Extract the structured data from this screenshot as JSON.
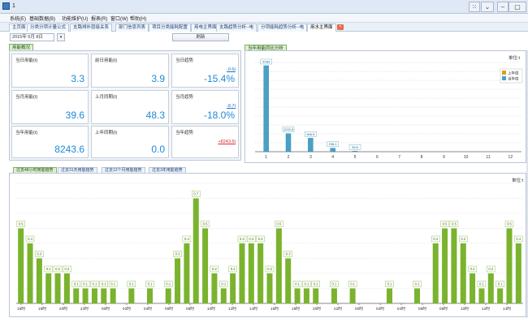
{
  "window": {
    "title": "1"
  },
  "menu": [
    "系统(E)",
    "基础数据(B)",
    "功能维护(U)",
    "报表(R)",
    "窗口(W)",
    "帮助(H)"
  ],
  "tabs": [
    "主页面",
    "分类分项计量公式",
    "支路排补层级关系",
    "部门信息列表",
    "项目分类能耗配置",
    "用电主界面",
    "支路趋势分析--电",
    "分项能耗趋势分析--电",
    "用水主界面"
  ],
  "toolbar": {
    "date": "2015年 5月 8日",
    "refresh_label": "刷新"
  },
  "overview": {
    "tab_label": "用能概况",
    "cards": [
      {
        "label": "当日用能(t)",
        "value": "3.3",
        "sub": ""
      },
      {
        "label": "前日用能(t)",
        "value": "3.9",
        "sub": ""
      },
      {
        "label": "当日趋势",
        "value": "-15.4%",
        "sub": "-0.6t"
      },
      {
        "label": "当月用能(t)",
        "value": "39.6",
        "sub": ""
      },
      {
        "label": "上月同期(t)",
        "value": "48.3",
        "sub": ""
      },
      {
        "label": "当月趋势",
        "value": "-18.0%",
        "sub": "-8.7t"
      },
      {
        "label": "当年用能(t)",
        "value": "8243.6",
        "sub": ""
      },
      {
        "label": "上年同期(t)",
        "value": "0.0",
        "sub": ""
      },
      {
        "label": "当年趋势",
        "value": "",
        "sub": "+8243.6t"
      }
    ]
  },
  "year_chart": {
    "tab_label": "当年用能同比分析",
    "unit": "单位:t"
  },
  "bottom_tabs": [
    "过去48小时用能趋势",
    "过去31天用能趋势",
    "过去12个月用能趋势",
    "过去3年用能趋势"
  ],
  "bottom_chart": {
    "unit": "单位:t"
  },
  "colors": {
    "bar_green": "#7ab32e",
    "bar_blue": "#4aa1c5",
    "last_year": "#d89f1e",
    "accent": "#1e88d6"
  },
  "chart_data": [
    {
      "type": "bar",
      "categories": [
        "1",
        "2",
        "3",
        "4",
        "5",
        "6",
        "7",
        "8",
        "9",
        "10",
        "11",
        "12"
      ],
      "series": [
        {
          "name": "上年值",
          "values": [
            0,
            0,
            0,
            0,
            0,
            0,
            0,
            0,
            0,
            0,
            0,
            0
          ]
        },
        {
          "name": "当年值",
          "values": [
            5784.0,
            1215.0,
            906.5,
            238.1,
            39.6,
            0,
            0,
            0,
            0,
            0,
            0,
            0
          ]
        }
      ],
      "data_labels": [
        "5784",
        "1215.5",
        "906.5",
        "238.1",
        "39.6"
      ],
      "ylim": [
        0,
        6000
      ],
      "legend": "top-right"
    },
    {
      "type": "bar",
      "x_ticks": [
        "16时",
        "18时",
        "20时",
        "22时",
        "00时",
        "02时",
        "04时",
        "06时",
        "08时",
        "10时",
        "12时",
        "14时",
        "16时",
        "18时",
        "20时",
        "22时",
        "00时",
        "02时",
        "04时",
        "06时",
        "08时",
        "10时",
        "12时",
        "14时"
      ],
      "values": [
        0.5,
        0.4,
        0.3,
        0.2,
        0.2,
        0.2,
        0.1,
        0.1,
        0.1,
        0.1,
        0.1,
        0,
        0.1,
        0,
        0.1,
        0,
        0.1,
        0.3,
        0.4,
        0.7,
        0.5,
        0.2,
        0.1,
        0.2,
        0.4,
        0.4,
        0.4,
        0.2,
        0.5,
        0.3,
        0.1,
        0.1,
        0.1,
        0,
        0.1,
        0,
        0.1,
        0,
        0,
        0,
        0.1,
        0,
        0,
        0.1,
        0,
        0.4,
        0.5,
        0.5,
        0.4,
        0.2,
        0.1,
        0.2,
        0.1,
        0.5,
        0.4
      ],
      "data_labels": [
        "0.5",
        "0.4",
        "0.3",
        "0.2",
        "0.2",
        "0.2",
        "0.1",
        "0.1",
        "0.1",
        "0.1",
        "0.1",
        "",
        "0.1",
        "",
        "0.1",
        "",
        "0.1",
        "0.3",
        "0.4",
        "0.7",
        "0.5",
        "0.2",
        "0.1",
        "0.2",
        "0.4",
        "0.4",
        "0.4",
        "0.2",
        "0.5",
        "0.3",
        "0.1",
        "0.1",
        "0.1",
        "",
        "0.1",
        "",
        "0.1",
        "",
        "",
        "",
        "0.1",
        "",
        "",
        "0.1",
        "",
        "0.4",
        "0.5",
        "0.5",
        "0.4",
        "0.2",
        "0.1",
        "0.2",
        "0.1",
        "0.5",
        "0.4"
      ],
      "ylim": [
        0,
        0.8
      ]
    }
  ]
}
